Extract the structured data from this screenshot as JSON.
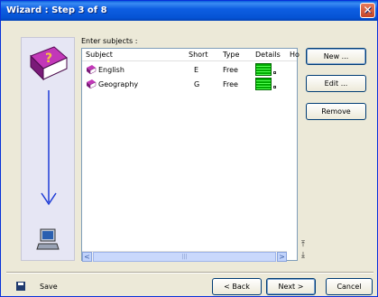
{
  "window": {
    "title": "Wizard : Step 3 of 8",
    "close_glyph": "✕"
  },
  "main": {
    "prompt": "Enter subjects :",
    "columns": [
      "Subject",
      "Short",
      "Type",
      "Details",
      "Ho"
    ],
    "rows": [
      {
        "subject": "English",
        "short": "E",
        "type": "Free"
      },
      {
        "subject": "Geography",
        "short": "G",
        "type": "Free"
      }
    ],
    "scroll": {
      "left": "<",
      "right": ">",
      "thumb": "|||"
    },
    "vertical_buttons": {
      "top": "⤒",
      "bottom": "⤓"
    }
  },
  "side_buttons": {
    "new": "New ...",
    "edit": "Edit ...",
    "remove": "Remove"
  },
  "footer": {
    "save": "Save",
    "back": "< Back",
    "next": "Next >",
    "cancel": "Cancel"
  },
  "colors": {
    "titlebar": "#0553d4",
    "sidebar": "#e6e6f4",
    "book": "#8b1c8f",
    "arrow": "#1e3cd6"
  },
  "icons": {
    "sidebar_top": "question-book-icon",
    "sidebar_bottom": "computer-icon",
    "subject": "book-icon",
    "save": "floppy-disk-icon"
  }
}
